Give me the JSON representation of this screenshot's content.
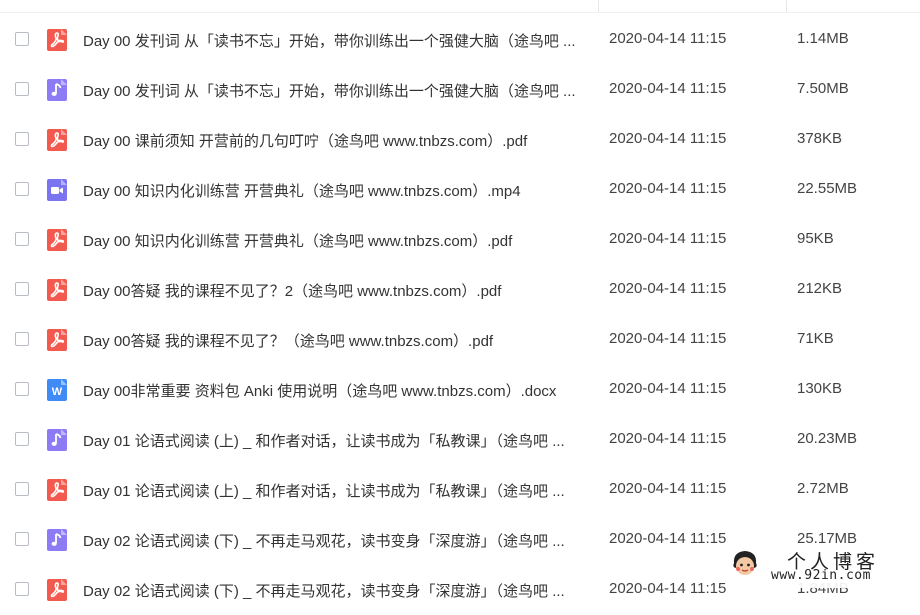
{
  "colors": {
    "pdf": "#f25a4f",
    "audio": "#8d7af5",
    "video": "#7a74f0",
    "word": "#3f8af5"
  },
  "files": [
    {
      "icon": "pdf-icon",
      "type": "pdf",
      "name": "Day 00 发刊词 从「读书不忘」开始，带你训练出一个强健大脑（途鸟吧 ...",
      "date": "2020-04-14 11:15",
      "size": "1.14MB"
    },
    {
      "icon": "audio-icon",
      "type": "audio",
      "name": "Day 00 发刊词 从「读书不忘」开始，带你训练出一个强健大脑（途鸟吧 ...",
      "date": "2020-04-14 11:15",
      "size": "7.50MB"
    },
    {
      "icon": "pdf-icon",
      "type": "pdf",
      "name": "Day 00 课前须知  开营前的几句叮咛（途鸟吧 www.tnbzs.com）.pdf",
      "date": "2020-04-14 11:15",
      "size": "378KB"
    },
    {
      "icon": "video-icon",
      "type": "video",
      "name": "Day 00 知识内化训练营  开营典礼（途鸟吧 www.tnbzs.com）.mp4",
      "date": "2020-04-14 11:15",
      "size": "22.55MB"
    },
    {
      "icon": "pdf-icon",
      "type": "pdf",
      "name": "Day 00 知识内化训练营  开营典礼（途鸟吧 www.tnbzs.com）.pdf",
      "date": "2020-04-14 11:15",
      "size": "95KB"
    },
    {
      "icon": "pdf-icon",
      "type": "pdf",
      "name": "Day 00答疑  我的课程不见了？2（途鸟吧 www.tnbzs.com）.pdf",
      "date": "2020-04-14 11:15",
      "size": "212KB"
    },
    {
      "icon": "pdf-icon",
      "type": "pdf",
      "name": "Day 00答疑  我的课程不见了？（途鸟吧 www.tnbzs.com）.pdf",
      "date": "2020-04-14 11:15",
      "size": "71KB"
    },
    {
      "icon": "word-icon",
      "type": "word",
      "name": "Day 00非常重要 资料包  Anki 使用说明（途鸟吧 www.tnbzs.com）.docx",
      "date": "2020-04-14 11:15",
      "size": "130KB"
    },
    {
      "icon": "audio-icon",
      "type": "audio",
      "name": "Day 01 论语式阅读 (上) _ 和作者对话，让读书成为「私教课」（途鸟吧 ...",
      "date": "2020-04-14 11:15",
      "size": "20.23MB"
    },
    {
      "icon": "pdf-icon",
      "type": "pdf",
      "name": "Day 01 论语式阅读 (上) _ 和作者对话，让读书成为「私教课」（途鸟吧 ...",
      "date": "2020-04-14 11:15",
      "size": "2.72MB"
    },
    {
      "icon": "audio-icon",
      "type": "audio",
      "name": "Day 02 论语式阅读 (下) _ 不再走马观花，读书变身「深度游」（途鸟吧 ...",
      "date": "2020-04-14 11:15",
      "size": "25.17MB"
    },
    {
      "icon": "pdf-icon",
      "type": "pdf",
      "name": "Day 02 论语式阅读 (下) _ 不再走马观花，读书变身「深度游」（途鸟吧 ...",
      "date": "2020-04-14 11:15",
      "size": "1.84MB"
    }
  ],
  "watermark": {
    "title": "个人博客",
    "url": "www.92in.com"
  }
}
